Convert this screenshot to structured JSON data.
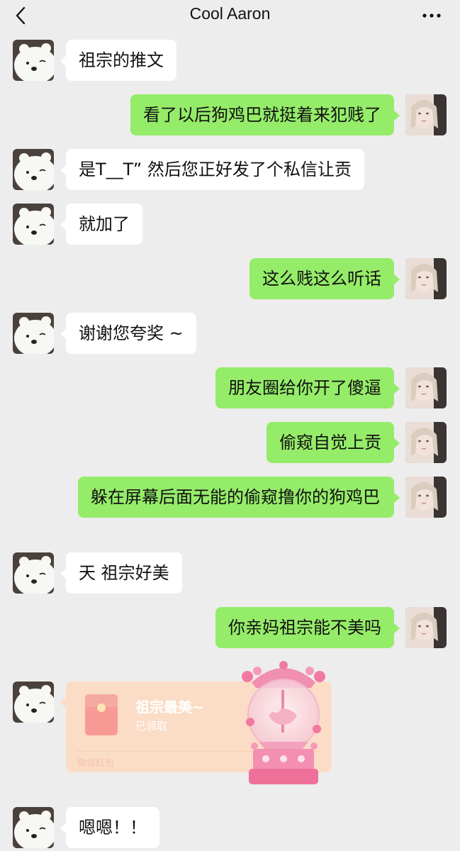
{
  "header": {
    "title": "Cool Aaron",
    "back_icon": "chevron-left-icon",
    "more_icon": "more-dots-icon"
  },
  "messages": [
    {
      "side": "left",
      "text": "祖宗的推文"
    },
    {
      "side": "right",
      "text": "看了以后狗鸡巴就挺着来犯贱了"
    },
    {
      "side": "left",
      "text": "是T__T” 然后您正好发了个私信让贡"
    },
    {
      "side": "left",
      "text": "就加了"
    },
    {
      "side": "right",
      "text": "这么贱这么听话"
    },
    {
      "side": "left",
      "text": "谢谢您夸奖 ~"
    },
    {
      "side": "right",
      "text": "朋友圈给你开了傻逼"
    },
    {
      "side": "right",
      "text": "偷窥自觉上贡"
    },
    {
      "side": "right",
      "text": "躲在屏幕后面无能的偷窥撸你的狗鸡巴"
    },
    {
      "side": "left",
      "text": "天 祖宗好美"
    },
    {
      "side": "right",
      "text": "你亲妈祖宗能不美吗"
    },
    {
      "side": "left",
      "text": "嗯嗯！！"
    }
  ],
  "red_packet": {
    "title": "祖宗最美~",
    "status": "已领取",
    "footer": "微信红包"
  },
  "colors": {
    "background": "#ededed",
    "bubble_left": "#ffffff",
    "bubble_right": "#95ec69",
    "red_packet": "#fbdcc6"
  }
}
